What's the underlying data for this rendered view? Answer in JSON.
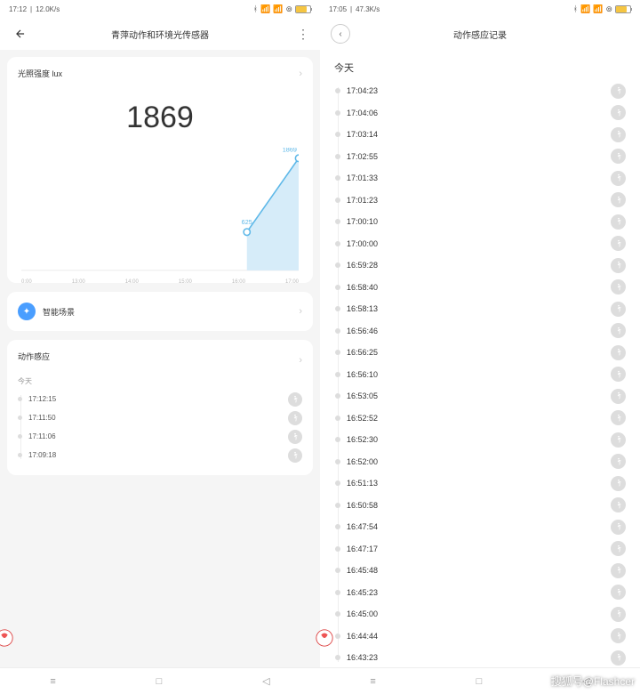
{
  "left": {
    "status": {
      "time": "17:12",
      "speed": "12.0K/s"
    },
    "header": {
      "title": "青萍动作和环境光传感器"
    },
    "lux_card": {
      "title": "光照强度 lux",
      "value": "1869"
    },
    "chart_data": {
      "type": "line",
      "x": [
        4.4,
        5.4
      ],
      "values": [
        625,
        1869
      ],
      "value_labels": [
        "625",
        "1869"
      ],
      "xticks": [
        "0:00",
        "13:00",
        "14:00",
        "15:00",
        "16:00",
        "17:00"
      ],
      "ylim": [
        0,
        2000
      ]
    },
    "scene": {
      "label": "智能场景"
    },
    "motion": {
      "title": "动作感应",
      "day": "今天",
      "items": [
        "17:12:15",
        "17:11:50",
        "17:11:06",
        "17:09:18"
      ]
    }
  },
  "right": {
    "status": {
      "time": "17:05",
      "speed": "47.3K/s"
    },
    "header": {
      "title": "动作感应记录"
    },
    "day": "今天",
    "items": [
      "17:04:23",
      "17:04:06",
      "17:03:14",
      "17:02:55",
      "17:01:33",
      "17:01:23",
      "17:00:10",
      "17:00:00",
      "16:59:28",
      "16:58:40",
      "16:58:13",
      "16:56:46",
      "16:56:25",
      "16:56:10",
      "16:53:05",
      "16:52:52",
      "16:52:30",
      "16:52:00",
      "16:51:13",
      "16:50:58",
      "16:47:54",
      "16:47:17",
      "16:45:48",
      "16:45:23",
      "16:45:00",
      "16:44:44",
      "16:43:23"
    ]
  },
  "watermark": "搜狐号@Flashcer"
}
